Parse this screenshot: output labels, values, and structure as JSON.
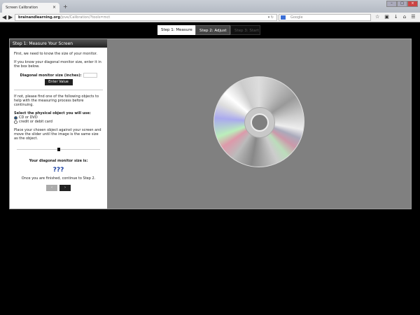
{
  "browser": {
    "tab_title": "Screen Calibration",
    "url_domain": "brainandlearning.org",
    "url_path": "/jove/Calibration/?tools=mct",
    "search_placeholder": "Google"
  },
  "steps": [
    {
      "label": "Step 1: Measure"
    },
    {
      "label": "Step 2: Adjust"
    },
    {
      "label": "Step 3: Start"
    }
  ],
  "panel": {
    "heading": "Step 1: Measure Your Screen",
    "intro": "First, we need to know the size of your monitor.",
    "known": "If you know your diagonal monitor size, enter it in the box below.",
    "size_label": "Diagonal monitor size (inches):",
    "size_value": "",
    "enter_button": "Enter Value",
    "ifnot": "If not, please find one of the following objects to help with the measuring process before continuing.",
    "select_label": "Select the physical object you will use:",
    "options": [
      {
        "label": "CD or DVD",
        "selected": true
      },
      {
        "label": "credit or debit card",
        "selected": false
      }
    ],
    "place": "Place your chosen object against your screen and move the slider until the image is the same size as the object.",
    "result_label": "Your diagonal monitor size is:",
    "result_value": "???",
    "finish": "Once you are finished, continue to Step 2.",
    "prev_button": "‹",
    "next_button": "›"
  }
}
